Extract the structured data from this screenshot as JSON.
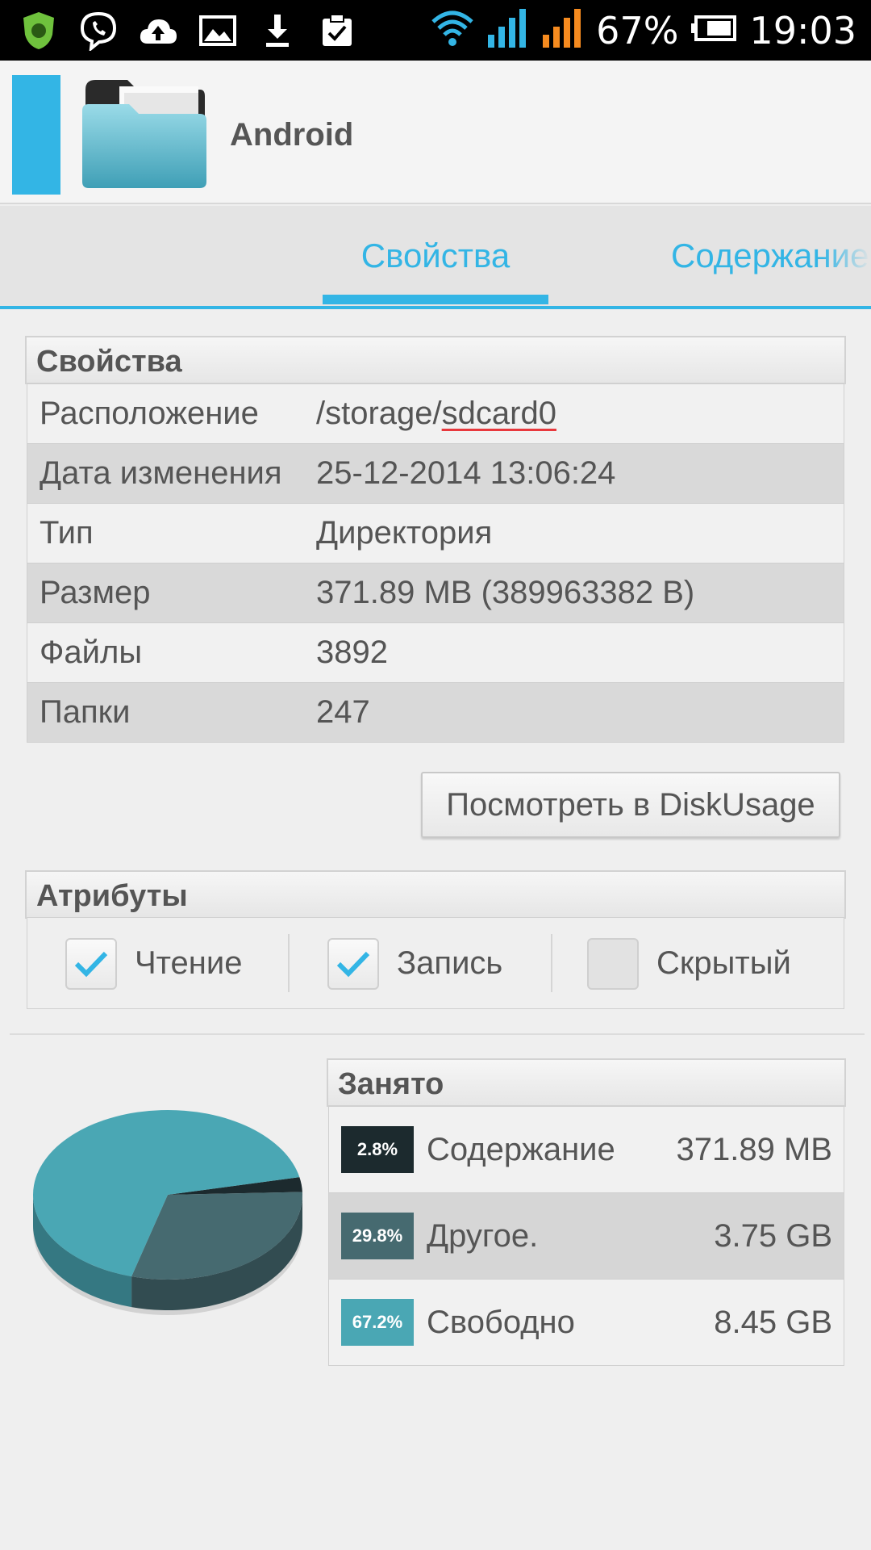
{
  "status_bar": {
    "battery": "67%",
    "time": "19:03",
    "icons": [
      "shield-icon",
      "viber-icon",
      "cloud-upload-icon",
      "gallery-icon",
      "download-icon",
      "clipboard-check-icon",
      "wifi-icon",
      "signal-icon",
      "signal-icon",
      "battery-icon"
    ]
  },
  "header": {
    "title": "Android",
    "accent_color": "#33b5e5"
  },
  "tabs": [
    {
      "label": "Свойства",
      "active": true
    },
    {
      "label": "Содержание",
      "active": false
    }
  ],
  "properties": {
    "header": "Свойства",
    "rows": [
      {
        "key": "Расположение",
        "value_prefix": "/storage/",
        "value_suffix": "sdcard0"
      },
      {
        "key": "Дата изменения",
        "value": "25-12-2014 13:06:24"
      },
      {
        "key": "Тип",
        "value": "Директория"
      },
      {
        "key": "Размер",
        "value": "371.89 MB (389963382 B)"
      },
      {
        "key": "Файлы",
        "value": "3892"
      },
      {
        "key": "Папки",
        "value": "247"
      }
    ]
  },
  "diskusage_button": "Посмотреть в DiskUsage",
  "attributes": {
    "header": "Атрибуты",
    "items": [
      {
        "label": "Чтение",
        "checked": true
      },
      {
        "label": "Запись",
        "checked": true
      },
      {
        "label": "Скрытый",
        "checked": false
      }
    ]
  },
  "usage": {
    "header": "Занято",
    "rows": [
      {
        "percent": "2.8%",
        "label": "Содержание",
        "size": "371.89 MB",
        "color": "#1c2a2e"
      },
      {
        "percent": "29.8%",
        "label": "Другое.",
        "size": "3.75 GB",
        "color": "#466a70"
      },
      {
        "percent": "67.2%",
        "label": "Свободно",
        "size": "8.45 GB",
        "color": "#4aa7b4"
      }
    ]
  },
  "chart_data": {
    "type": "pie",
    "categories": [
      "Содержание",
      "Другое.",
      "Свободно"
    ],
    "values": [
      2.8,
      29.8,
      67.2
    ],
    "colors": [
      "#1c2a2e",
      "#466a70",
      "#4aa7b4"
    ]
  }
}
